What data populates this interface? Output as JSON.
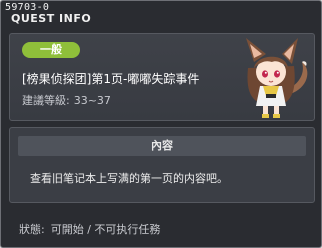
{
  "window": {
    "quest_id": "59703-0",
    "title": "QUEST INFO"
  },
  "quest": {
    "category": "一般",
    "name": "[榜果侦探团]第1页-嘟嘟失踪事件",
    "level_label": "建議等級:",
    "level_range": "33~37"
  },
  "content": {
    "header": "內容",
    "text": "查看旧笔记本上写满的第一页的内容吧。"
  },
  "status": {
    "label": "狀態:",
    "value": "可開始 / 不可执行任務"
  },
  "colors": {
    "tag": "#8fbf3a",
    "background": "#2a2c31",
    "panel": "#3b3e45"
  },
  "icons": {
    "npc": "fox-girl-npc-portrait"
  }
}
